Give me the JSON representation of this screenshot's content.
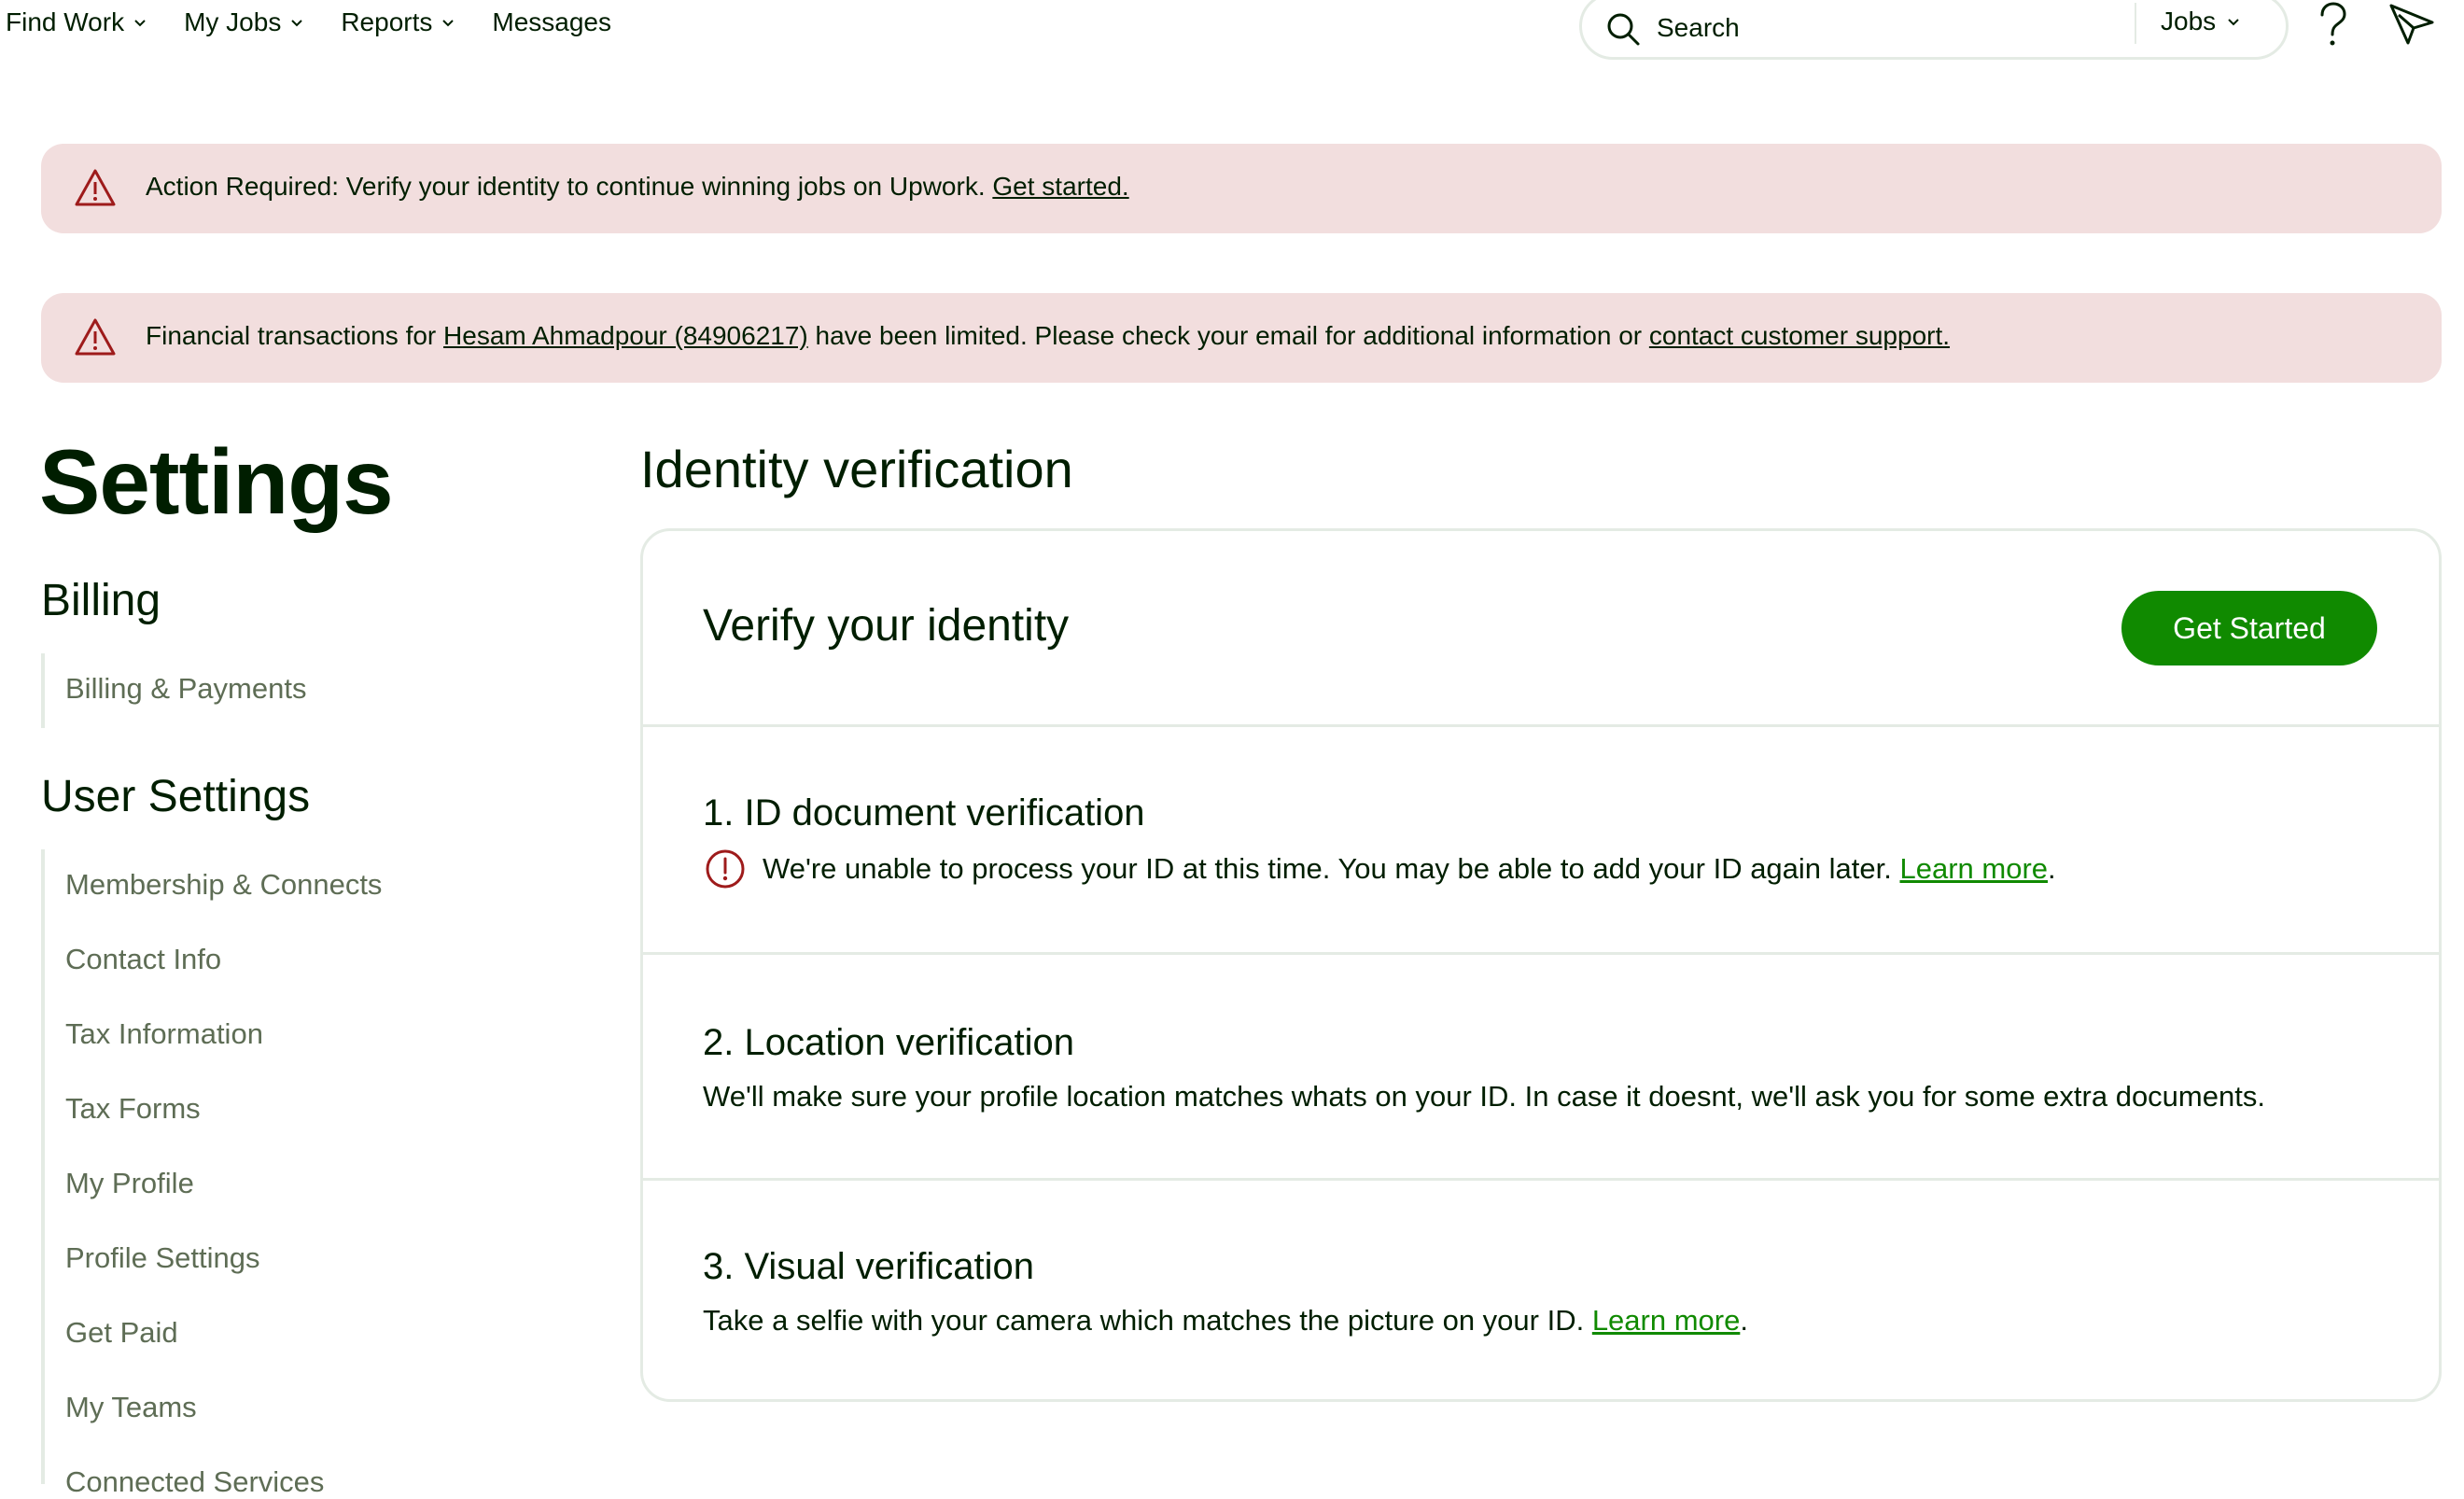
{
  "nav": {
    "items": [
      {
        "label": "Find Work",
        "has_dropdown": true
      },
      {
        "label": "My Jobs",
        "has_dropdown": true
      },
      {
        "label": "Reports",
        "has_dropdown": true
      },
      {
        "label": "Messages",
        "has_dropdown": false
      }
    ],
    "search": {
      "placeholder": "Search",
      "type_label": "Jobs"
    },
    "icons": {
      "search": "search-icon",
      "help": "help-icon",
      "send": "send-icon"
    }
  },
  "alerts": [
    {
      "icon": "warning-icon",
      "text": "Action Required: Verify your identity to continue winning jobs on Upwork. ",
      "link": "Get started."
    },
    {
      "icon": "warning-icon",
      "prefix": "Financial transactions for ",
      "account_link": "Hesam Ahmadpour (84906217)",
      "middle": " have been limited. Please check your email for additional information or ",
      "support_link": "contact customer support."
    }
  ],
  "sidebar": {
    "title": "Settings",
    "billing": {
      "heading": "Billing",
      "items": [
        "Billing & Payments"
      ]
    },
    "user_settings": {
      "heading": "User Settings",
      "items": [
        "Membership & Connects",
        "Contact Info",
        "Tax Information",
        "Tax Forms",
        "My Profile",
        "Profile Settings",
        "Get Paid",
        "My Teams",
        "Connected Services"
      ]
    }
  },
  "main": {
    "title": "Identity verification",
    "card": {
      "header": "Verify your identity",
      "button": "Get Started",
      "steps": [
        {
          "title": "1. ID document verification",
          "text": "We're unable to process your ID at this time. You may be able to add your ID again later. ",
          "link": "Learn more",
          "suffix": "."
        },
        {
          "title": "2. Location verification",
          "text": "We'll make sure your profile location matches whats on your ID. In case it doesnt, we'll ask you for some extra documents."
        },
        {
          "title": "3. Visual verification",
          "text": "Take a selfie with your camera which matches the picture on your ID. ",
          "link": "Learn more",
          "suffix": "."
        }
      ]
    }
  },
  "colors": {
    "accent_green": "#108a00",
    "alert_bg": "#f2dede",
    "alert_icon": "#9e1b1b",
    "text": "#001e00",
    "muted_text": "#5e6d55",
    "border": "#e4ebe4"
  }
}
